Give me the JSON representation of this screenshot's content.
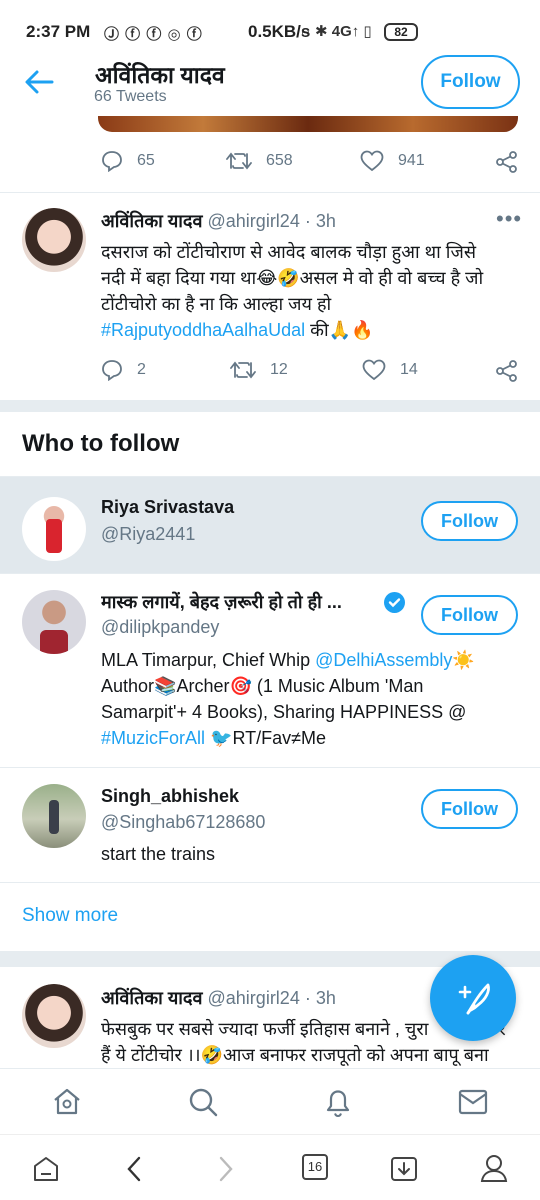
{
  "status_bar": {
    "time": "2:37 PM",
    "notification_icons": "Ⓙ ⓕ ⓕ ◎ ⓕ",
    "network_speed": "0.5KB/s",
    "indicators": "∩ ✱ 4G↑ ▯",
    "battery": "82"
  },
  "header": {
    "name": "अविंतिका यादव",
    "tweet_count": "66 Tweets",
    "follow_label": "Follow"
  },
  "prev_tweet": {
    "replies": "65",
    "retweets": "658",
    "likes": "941"
  },
  "tweet1": {
    "name": "अविंतिका यादव",
    "handle_time": "@ahirgirl24 · 3h",
    "line1": "दसराज को टोंटीचोराण से आवेद बालक चौड़ा हुआ था जिसे",
    "line2": "नदी में बहा दिया गया था😂🤣असल मे वो ही वो बच्च है जो",
    "line3": "टोंटीचोरो का है ना कि आल्हा जय हो",
    "hashtag": "#RajputyoddhaAalhaUdal",
    "after_hashtag": " की🙏🔥",
    "replies": "2",
    "retweets": "12",
    "likes": "14"
  },
  "who_to_follow": {
    "title": "Who to follow",
    "users": [
      {
        "name": "Riya Srivastava",
        "handle": "@Riya2441",
        "follow_label": "Follow"
      },
      {
        "name": "मास्क लगायें, बेहद ज़रूरी हो तो ही ...",
        "handle": "@dilipkpandey",
        "follow_label": "Follow",
        "bio_line1_a": "MLA Timarpur, Chief Whip ",
        "bio_line1_link": "@DelhiAssembly",
        "bio_line1_b": "☀️",
        "bio_line2": "Author📚Archer🎯 (1 Music Album 'Man",
        "bio_line3": "Samarpit'+ 4 Books), Sharing HAPPINESS @",
        "bio_line4_link": "#MuzicForAll",
        "bio_line4_b": " 🐦RT/Fav≠Me"
      },
      {
        "name": "Singh_abhishek",
        "handle": "@Singhab67128680",
        "follow_label": "Follow",
        "bio": "start the trains"
      }
    ],
    "show_more": "Show more"
  },
  "tweet2": {
    "name": "अविंतिका यादव",
    "handle_time": "@ahirgirl24 · 3h",
    "line1": "फेसबुक पर सबसे ज्यादा फर्जी इतिहास बनाने , चुरा",
    "line1_tail": "र",
    "line2": "हैं ये टोंटीचोर ।।🤣आज बनाफर राजपूतो को अपना बापू बना"
  },
  "browser_bar": {
    "tab_count": "16"
  },
  "colors": {
    "accent": "#1da1f2",
    "secondary_text": "#657786",
    "divider": "#e6ecf0",
    "highlight_row": "#e1e8ed"
  }
}
